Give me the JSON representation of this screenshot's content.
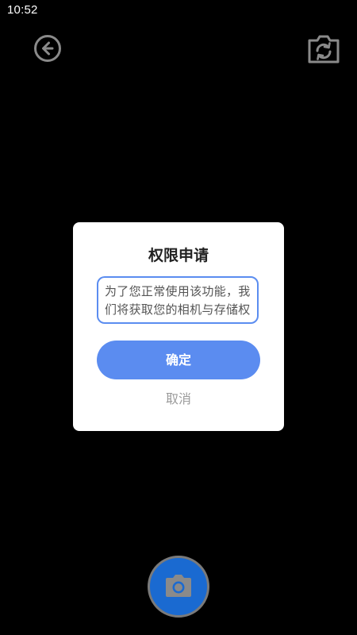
{
  "status_bar": {
    "time": "10:52"
  },
  "camera": {
    "back_icon": "back-arrow-circle-icon",
    "switch_icon": "switch-camera-icon",
    "shutter_icon": "camera-icon"
  },
  "dialog": {
    "title": "权限申请",
    "message": "为了您正常使用该功能，我们将获取您的相机与存储权限",
    "confirm_label": "确定",
    "cancel_label": "取消"
  },
  "colors": {
    "background": "#000000",
    "accent": "#5b8cf0",
    "shutter": "#1a6ad1",
    "icon_gray": "#8a8a8a"
  }
}
